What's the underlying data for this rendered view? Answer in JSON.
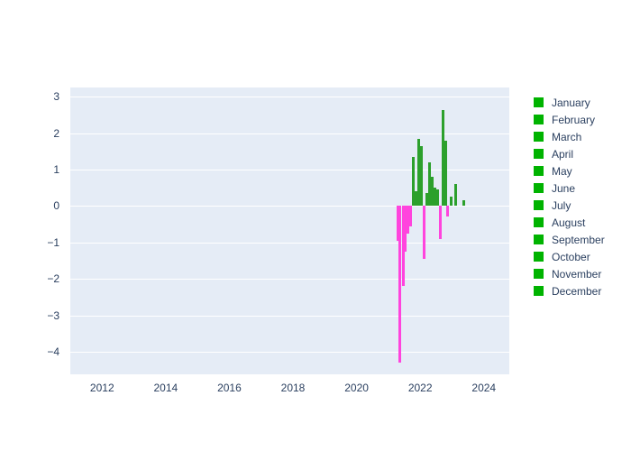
{
  "chart": {
    "type": "bar",
    "background_color": "#ffffff",
    "plot_background_color": "#e5ecf6",
    "gridline_color": "#ffffff",
    "tick_text_color": "#2a3f5f",
    "positive_color": "#2ca02c",
    "negative_color": "#ff44dd",
    "legend_marker_color": "#00b300"
  },
  "chart_data": {
    "type": "bar",
    "title": "",
    "xlabel": "",
    "ylabel": "",
    "xlim": [
      2011.0,
      2024.8
    ],
    "ylim": [
      -4.62,
      3.25
    ],
    "grid": true,
    "legend_position": "right",
    "xticks": [
      2012,
      2014,
      2016,
      2018,
      2020,
      2022,
      2024
    ],
    "yticks": [
      3,
      2,
      1,
      0,
      -1,
      -2,
      -3,
      -4
    ],
    "legend": [
      "January",
      "February",
      "March",
      "April",
      "May",
      "June",
      "July",
      "August",
      "September",
      "October",
      "November",
      "December"
    ],
    "x": [
      2021.29,
      2021.37,
      2021.46,
      2021.54,
      2021.62,
      2021.71,
      2021.79,
      2021.87,
      2021.96,
      2022.04,
      2022.12,
      2022.21,
      2022.29,
      2022.37,
      2022.46,
      2022.54,
      2022.62,
      2022.71,
      2022.79,
      2022.87,
      2022.96,
      2023.12,
      2023.37
    ],
    "values": [
      -0.95,
      -4.3,
      -2.2,
      -1.25,
      -0.75,
      -0.55,
      1.35,
      0.4,
      1.85,
      1.65,
      -1.45,
      0.35,
      1.2,
      0.8,
      0.5,
      0.45,
      -0.9,
      2.62,
      1.8,
      -0.3,
      0.25,
      0.6,
      0.15
    ]
  }
}
